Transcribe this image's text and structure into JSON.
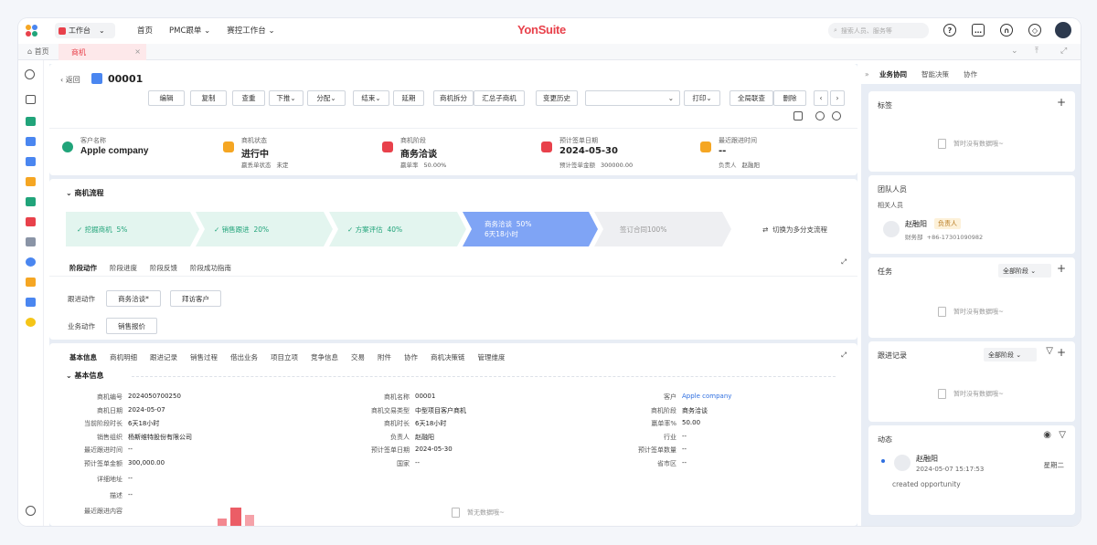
{
  "topbar": {
    "workspace": "工作台",
    "nav": [
      "首页",
      "PMC跟单",
      "赛控工作台"
    ],
    "brand": "YonSuite",
    "search_placeholder": "搜索人员、服务等"
  },
  "tabs": {
    "home": "首页",
    "active": "商机"
  },
  "record": {
    "back": "返回",
    "title": "00001"
  },
  "toolbar": {
    "buttons": [
      "编辑",
      "复制",
      "查重",
      "下推",
      "分配",
      "结束",
      "延期",
      "商机拆分",
      "汇总子商机",
      "变更历史",
      "打印",
      "全局联查",
      "删除"
    ]
  },
  "summary": [
    {
      "key": "客户名称",
      "value": "Apple company",
      "sub_k": "",
      "sub_v": ""
    },
    {
      "key": "商机状态",
      "value": "进行中",
      "sub_k": "赢丢单状态",
      "sub_v": "未定"
    },
    {
      "key": "商机阶段",
      "value": "商务洽谈",
      "sub_k": "赢单率",
      "sub_v": "50.00%"
    },
    {
      "key": "预计签单日期",
      "value": "2024-05-30",
      "sub_k": "预计签单金额",
      "sub_v": "300000.00"
    },
    {
      "key": "最近跟进时间",
      "value": "--",
      "sub_k": "负责人",
      "sub_v": "赵融阳"
    }
  ],
  "flow": {
    "title": "商机流程",
    "steps": [
      {
        "label": "挖掘商机",
        "pct": "5%",
        "status": "done"
      },
      {
        "label": "销售跟进",
        "pct": "20%",
        "status": "done"
      },
      {
        "label": "方案评估",
        "pct": "40%",
        "status": "done"
      },
      {
        "label": "商务洽谈",
        "pct": "50%",
        "status": "current",
        "duration": "6天18小时"
      },
      {
        "label": "签订合同",
        "pct": "100%",
        "status": "todo"
      }
    ],
    "switch": "切换为多分支流程",
    "subtabs": [
      "阶段动作",
      "阶段进度",
      "阶段反馈",
      "阶段成功指南"
    ],
    "actions": {
      "followup_label": "跟进动作",
      "followup": [
        "商务洽谈*",
        "拜访客户"
      ],
      "biz_label": "业务动作",
      "biz": [
        "销售报价"
      ]
    }
  },
  "info": {
    "tabs": [
      "基本信息",
      "商机明细",
      "跟进记录",
      "销售过程",
      "借出业务",
      "项目立项",
      "竞争信息",
      "交易",
      "附件",
      "协作",
      "商机决策链",
      "管理维度"
    ],
    "section": "基本信息",
    "col1": [
      [
        "商机编号",
        "2024050700250"
      ],
      [
        "商机日期",
        "2024-05-07"
      ],
      [
        "当前阶段时长",
        "6天18小时"
      ],
      [
        "销售组织",
        "杨斯维特股份有限公司"
      ],
      [
        "最近跟进时间",
        "--"
      ],
      [
        "预计签单金额",
        "300,000.00"
      ],
      [
        "详细地址",
        "--"
      ],
      [
        "描述",
        "--"
      ],
      [
        "最近跟进内容",
        ""
      ]
    ],
    "col2": [
      [
        "商机名称",
        "00001"
      ],
      [
        "商机交易类型",
        "中型项目客户商机"
      ],
      [
        "商机时长",
        "6天18小时"
      ],
      [
        "负责人",
        "赵融阳"
      ],
      [
        "预计签单日期",
        "2024-05-30"
      ],
      [
        "国家",
        "--"
      ]
    ],
    "col3": [
      [
        "客户",
        "Apple company"
      ],
      [
        "商机阶段",
        "商务洽谈"
      ],
      [
        "赢单率%",
        "50.00"
      ],
      [
        "行业",
        "--"
      ],
      [
        "预计签单数量",
        "--"
      ],
      [
        "省市区",
        "--"
      ]
    ],
    "empty": "暂无数据哦~"
  },
  "right": {
    "tabs": [
      "业务协同",
      "智能决策",
      "协作"
    ],
    "tag": {
      "title": "标签",
      "empty": "暂时没有数据哦~"
    },
    "team": {
      "title": "团队人员",
      "sub": "相关人员",
      "name": "赵融阳",
      "badge": "负责人",
      "role": "财务部",
      "phone": "+86-17301090982"
    },
    "task": {
      "title": "任务",
      "filter": "全部阶段",
      "empty": "暂时没有数据哦~"
    },
    "follow": {
      "title": "跟进记录",
      "filter": "全部阶段",
      "empty": "暂时没有数据哦~"
    },
    "feed": {
      "title": "动态",
      "name": "赵融阳",
      "time": "2024-05-07 15:17:53",
      "weekday": "星期二",
      "text": "created opportunity"
    }
  },
  "colors": {
    "accent": "#e8414b",
    "primary": "#2f6fe0",
    "done": "#21a47a",
    "current": "#7fa4f5"
  }
}
